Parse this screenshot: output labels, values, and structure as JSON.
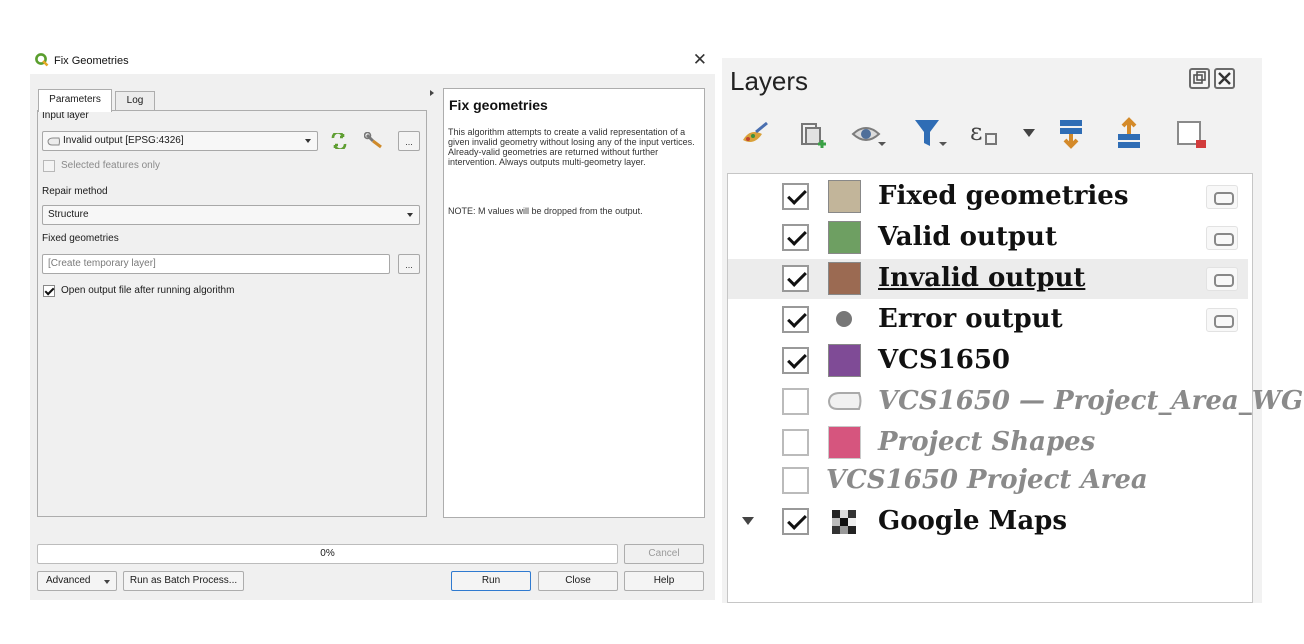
{
  "dialog": {
    "title": "Fix Geometries",
    "tabs": [
      {
        "label": "Parameters",
        "active": true
      },
      {
        "label": "Log",
        "active": false
      }
    ],
    "input_layer": {
      "label": "Input layer",
      "value": "Invalid output [EPSG:4326]",
      "browse": "..."
    },
    "selected_only": {
      "label": "Selected features only",
      "checked": false
    },
    "repair_method": {
      "label": "Repair method",
      "value": "Structure"
    },
    "output": {
      "label": "Fixed geometries",
      "placeholder": "[Create temporary layer]",
      "browse": "..."
    },
    "open_after": {
      "label": "Open output file after running algorithm",
      "checked": true
    },
    "help": {
      "title": "Fix geometries",
      "body": "This algorithm attempts to create a valid representation of a given invalid geometry without losing any of the input vertices. Already-valid geometries are returned without further intervention. Always outputs multi-geometry layer.",
      "note": "NOTE: M values will be dropped from the output."
    },
    "progress": {
      "value": 0,
      "label": "0%"
    },
    "buttons": {
      "cancel": "Cancel",
      "advanced": "Advanced",
      "batch": "Run as Batch Process...",
      "run": "Run",
      "close": "Close",
      "help": "Help"
    }
  },
  "layers_panel": {
    "title": "Layers",
    "toolbar_icons": [
      "style-paint-icon",
      "add-group-icon",
      "visibility-eye-icon",
      "filter-legend-icon",
      "expression-filter-icon",
      "dropdown-arrow-icon",
      "expand-all-icon",
      "collapse-all-icon",
      "remove-layer-icon"
    ],
    "layers": [
      {
        "name": "Fixed geometries",
        "checked": true,
        "swatch": "#c2b59a",
        "symbol": "square",
        "visible_style": "normal",
        "indicator": true
      },
      {
        "name": "Valid output",
        "checked": true,
        "swatch": "#6e9f62",
        "symbol": "square",
        "visible_style": "normal",
        "indicator": true
      },
      {
        "name": "Invalid output",
        "checked": true,
        "swatch": "#9b6a52",
        "symbol": "square",
        "visible_style": "normal",
        "indicator": true,
        "selected": true
      },
      {
        "name": "Error output",
        "checked": true,
        "swatch": "#777777",
        "symbol": "dot",
        "visible_style": "normal",
        "indicator": true
      },
      {
        "name": "VCS1650",
        "checked": true,
        "swatch": "#7f4b96",
        "symbol": "square",
        "visible_style": "normal",
        "indicator": false
      },
      {
        "name": "VCS1650 — Project_Area_WG",
        "checked": false,
        "swatch": "",
        "symbol": "polygon",
        "visible_style": "hidden",
        "indicator": false
      },
      {
        "name": "Project Shapes",
        "checked": false,
        "swatch": "#d6557e",
        "symbol": "square",
        "visible_style": "hidden",
        "indicator": false
      },
      {
        "name": "VCS1650 Project Area",
        "checked": false,
        "swatch": "",
        "symbol": "none",
        "visible_style": "hidden",
        "indicator": false
      },
      {
        "name": "Google Maps",
        "checked": true,
        "swatch": "",
        "symbol": "raster",
        "visible_style": "normal",
        "indicator": false,
        "expandable": true
      }
    ]
  }
}
